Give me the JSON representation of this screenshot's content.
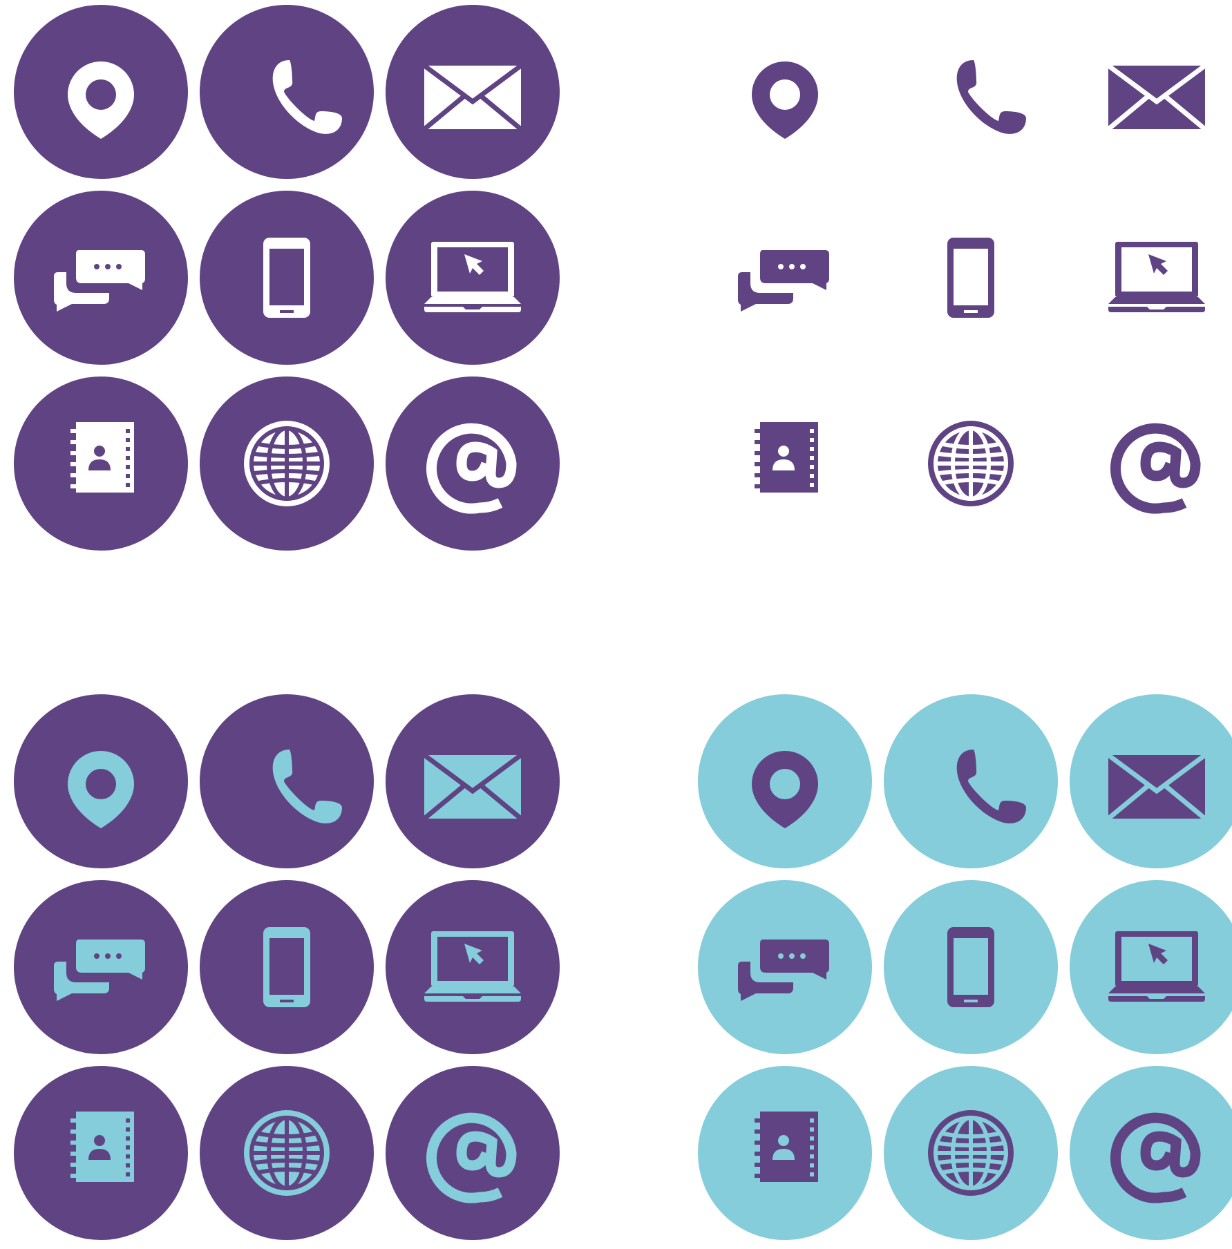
{
  "colors": {
    "purple": "#5f4383",
    "cyan": "#85cdda",
    "white": "#ffffff",
    "background": "#ffffff"
  },
  "icons": [
    "location-pin",
    "phone",
    "envelope",
    "chat-bubbles",
    "smartphone",
    "laptop-cursor",
    "address-book",
    "globe",
    "at-sign"
  ],
  "sets": [
    {
      "name": "white-on-purple",
      "circle": "#5f4383",
      "icon": "#ffffff",
      "stroke": "#5f4383"
    },
    {
      "name": "purple-no-circle",
      "circle": "none",
      "icon": "#5f4383",
      "stroke": "#ffffff"
    },
    {
      "name": "cyan-on-purple",
      "circle": "#5f4383",
      "icon": "#85cdda",
      "stroke": "#5f4383"
    },
    {
      "name": "purple-on-cyan",
      "circle": "#85cdda",
      "icon": "#5f4383",
      "stroke": "#85cdda"
    }
  ]
}
